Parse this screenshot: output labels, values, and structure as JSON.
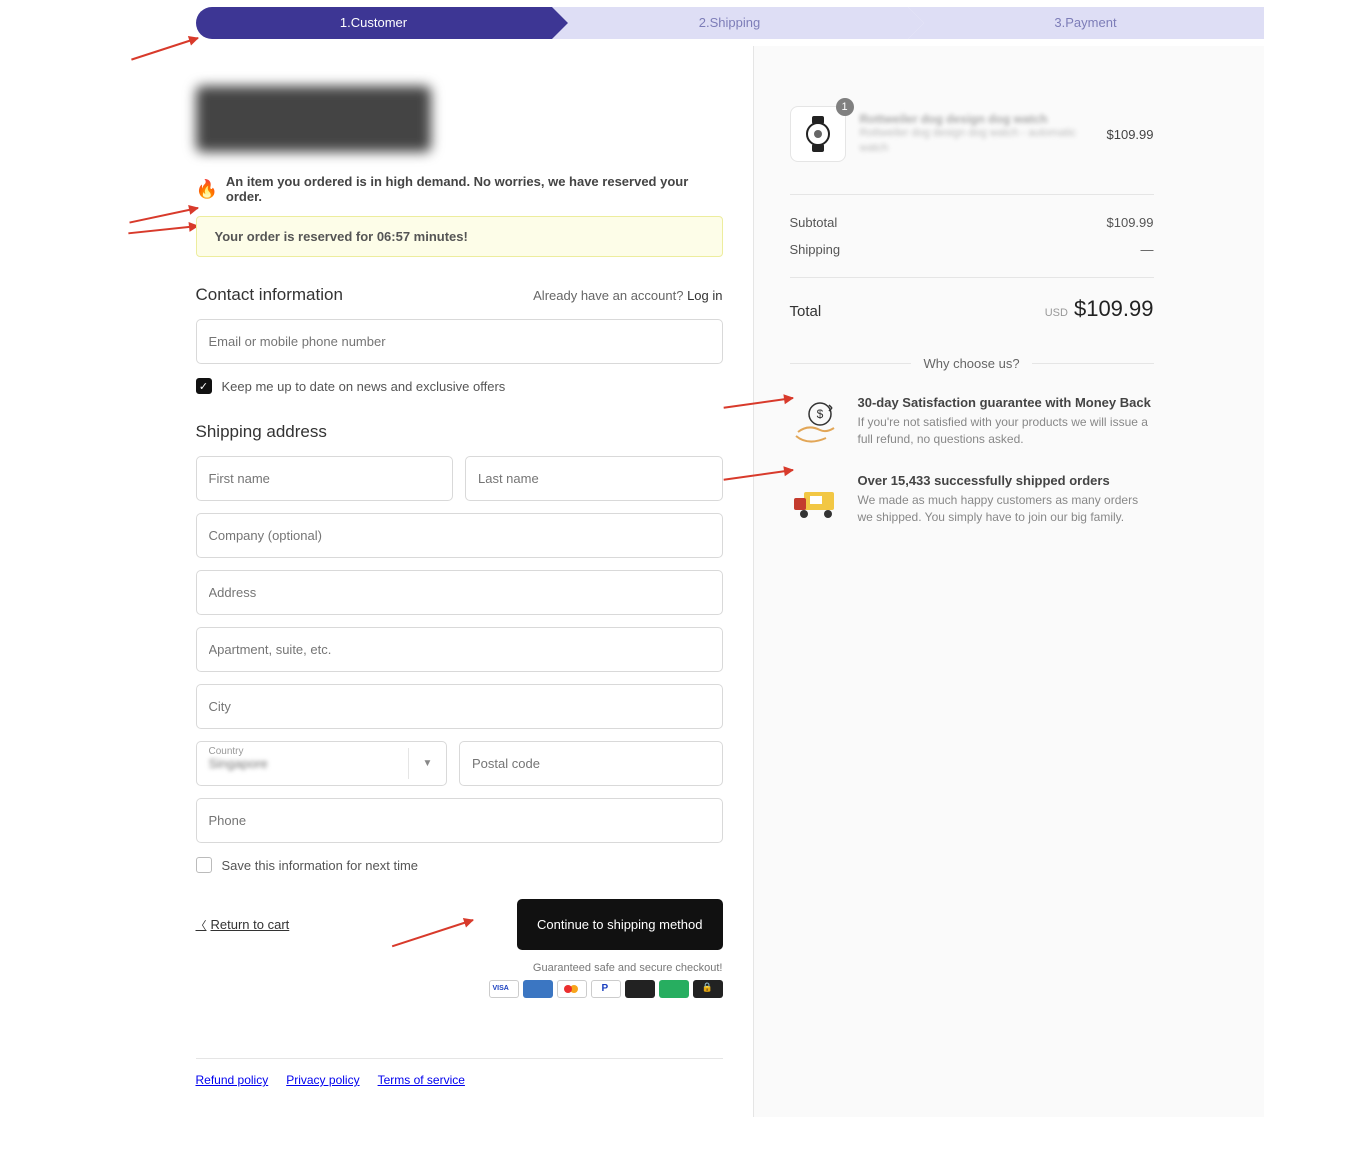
{
  "steps": {
    "s1": "1.Customer",
    "s2": "2.Shipping",
    "s3": "3.Payment"
  },
  "demand": {
    "text": "An item you ordered is in high demand. No worries, we have reserved your order.",
    "reserved": "Your order is reserved for 06:57 minutes!"
  },
  "contact": {
    "title": "Contact information",
    "hint_prefix": "Already have an account? ",
    "login": "Log in",
    "email_ph": "Email or mobile phone number",
    "newsletter": "Keep me up to date on news and exclusive offers"
  },
  "shipping": {
    "title": "Shipping address",
    "first_ph": "First name",
    "last_ph": "Last name",
    "company_ph": "Company (optional)",
    "address_ph": "Address",
    "apt_ph": "Apartment, suite, etc.",
    "city_ph": "City",
    "country_lbl": "Country",
    "country_val": "Singapore",
    "postal_ph": "Postal code",
    "phone_ph": "Phone",
    "save_info": "Save this information for next time"
  },
  "actions": {
    "return": "Return to cart",
    "continue": "Continue to shipping method",
    "secure": "Guaranteed safe and secure checkout!"
  },
  "footer": {
    "refund": "Refund policy",
    "privacy": "Privacy policy",
    "terms": "Terms of service"
  },
  "cart": {
    "qty": "1",
    "title": "Rottweiler dog design dog watch",
    "sub": "Rottweiler dog design dog watch - automatic watch",
    "price": "$109.99"
  },
  "summary": {
    "subtotal_lbl": "Subtotal",
    "subtotal": "$109.99",
    "shipping_lbl": "Shipping",
    "shipping": "—",
    "total_lbl": "Total",
    "currency": "USD",
    "total": "$109.99"
  },
  "why": {
    "heading": "Why choose us?",
    "b1_title": "30-day Satisfaction guarantee with Money Back",
    "b1_text": "If you're not satisfied with your products we will issue a full refund, no questions asked.",
    "b2_title": "Over 15,433 successfully shipped orders",
    "b2_text": "We made as much happy customers as many orders we shipped. You simply have to join our big family."
  }
}
